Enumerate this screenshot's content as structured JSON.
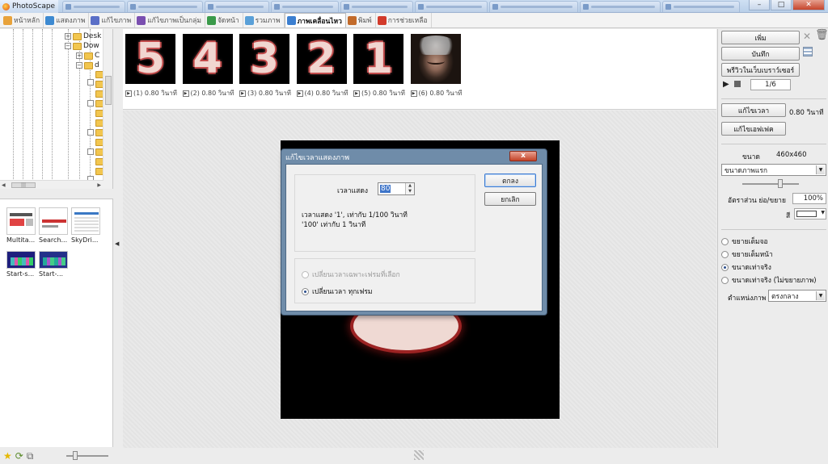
{
  "window": {
    "title": "PhotoScape",
    "controls": [
      "–",
      "□",
      "✕"
    ]
  },
  "menu": {
    "tabs": [
      {
        "label": "หน้าหลัก",
        "color": "#e8a23a",
        "active": false
      },
      {
        "label": "แสดงภาพ",
        "color": "#3d8ad1",
        "active": false
      },
      {
        "label": "แก้ไขภาพ",
        "color": "#5a6fc7",
        "active": false
      },
      {
        "label": "แก้ไขภาพเป็นกลุ่ม",
        "color": "#7a4fb0",
        "active": false
      },
      {
        "label": "จัดหน้า",
        "color": "#3a9a4a",
        "active": false
      },
      {
        "label": "รวมภาพ",
        "color": "#5aa0d8",
        "active": false
      },
      {
        "label": "ภาพเคลื่อนไหว",
        "color": "#3c7fd0",
        "active": true
      },
      {
        "label": "พิมพ์",
        "color": "#c26a2a",
        "active": false
      },
      {
        "label": "การช่วยเหลือ",
        "color": "#d23a2a",
        "active": false
      }
    ]
  },
  "tree": {
    "nodes": [
      {
        "label": "Desk",
        "expander": "+"
      },
      {
        "label": "Dow",
        "expander": "−"
      },
      {
        "label": "C",
        "expander": "+"
      },
      {
        "label": "d",
        "expander": "−"
      }
    ]
  },
  "thumbnails": [
    {
      "label": "Multita..."
    },
    {
      "label": "Search..."
    },
    {
      "label": "SkyDri..."
    },
    {
      "label": "Start-s..."
    },
    {
      "label": "Start-..."
    }
  ],
  "frames": [
    {
      "symbol": "5",
      "label": "(1) 0.80 วินาที"
    },
    {
      "symbol": "4",
      "label": "(2) 0.80 วินาที"
    },
    {
      "symbol": "3",
      "label": "(3) 0.80 วินาที"
    },
    {
      "symbol": "2",
      "label": "(4) 0.80 วินาที"
    },
    {
      "symbol": "1",
      "label": "(5) 0.80 วินาที"
    },
    {
      "symbol": "",
      "label": "(6) 0.80 วินาที"
    }
  ],
  "right_panel": {
    "add_label": "เพิ่ม",
    "save_label": "บันทึก",
    "preview_browser_label": "พรีวิวในเว็บเบราว์เซอร์",
    "frame_counter": "1/6",
    "edit_time_label": "แก้ไขเวลา",
    "time_value": "0.80 วินาที",
    "edit_effect_label": "แก้ไขเอฟเฟค",
    "size_label": "ขนาด",
    "size_value": "460x460",
    "size_select": "ขนาดภาพแรก",
    "scale_label": "อัตราส่วน ย่อ/ขยาย",
    "scale_value": "100%",
    "color_label": "สี",
    "fit_options": [
      {
        "label": "ขยายเต็มจอ",
        "checked": false
      },
      {
        "label": "ขยายเต็มหน้า",
        "checked": false
      },
      {
        "label": "ขนาดเท่าจริง",
        "checked": true
      },
      {
        "label": "ขนาดเท่าจริง (ไม่ขยายภาพ)",
        "checked": false
      }
    ],
    "position_label": "ตำแหน่งภาพ",
    "position_value": "ตรงกลาง"
  },
  "dialog": {
    "title": "แก้ไขเวลาแสดงภาพ",
    "close": "x",
    "duration_label": "เวลาแสดง",
    "duration_value": "80",
    "hint_line1": "เวลาแสดง  '1', เท่ากับ 1/100 วินาที",
    "hint_line2": "'100' เท่ากับ 1 วินาที",
    "opt_selected_only": "เปลี่ยนเวลาเฉพาะเฟรมที่เลือก",
    "opt_all_frames": "เปลี่ยนเวลา ทุกเฟรม",
    "ok_label": "ตกลง",
    "cancel_label": "ยกเลิก"
  }
}
